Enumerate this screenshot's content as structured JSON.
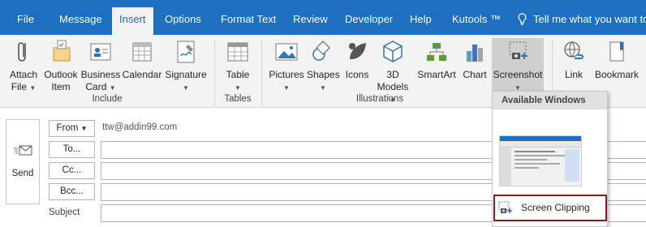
{
  "tabs": [
    {
      "label": "File",
      "active": false
    },
    {
      "label": "Message",
      "active": false
    },
    {
      "label": "Insert",
      "active": true
    },
    {
      "label": "Options",
      "active": false
    },
    {
      "label": "Format Text",
      "active": false
    },
    {
      "label": "Review",
      "active": false
    },
    {
      "label": "Developer",
      "active": false
    },
    {
      "label": "Help",
      "active": false
    },
    {
      "label": "Kutools ™",
      "active": false
    }
  ],
  "tell_me": "Tell me what you want to",
  "ribbon": {
    "buttons": {
      "attach": {
        "line1": "Attach",
        "line2": "File"
      },
      "outlook_item": {
        "line1": "Outlook",
        "line2": "Item"
      },
      "business_card": {
        "line1": "Business",
        "line2": "Card"
      },
      "calendar": {
        "line1": "Calendar"
      },
      "signature": {
        "line1": "Signature"
      },
      "table": {
        "line1": "Table"
      },
      "pictures": {
        "line1": "Pictures"
      },
      "shapes": {
        "line1": "Shapes"
      },
      "icons": {
        "line1": "Icons"
      },
      "models_3d": {
        "line1": "3D",
        "line2": "Models"
      },
      "smartart": {
        "line1": "SmartArt"
      },
      "chart": {
        "line1": "Chart"
      },
      "screenshot": {
        "line1": "Screenshot"
      },
      "link": {
        "line1": "Link"
      },
      "bookmark": {
        "line1": "Bookmark"
      }
    },
    "groups": {
      "include": "Include",
      "tables": "Tables",
      "illustrations": "Illustrations"
    }
  },
  "compose": {
    "send": "Send",
    "from_button": "From",
    "from_address": "ttw@addin99.com",
    "to_button": "To...",
    "cc_button": "Cc...",
    "bcc_button": "Bcc...",
    "subject_label": "Subject"
  },
  "screenshot_menu": {
    "header": "Available Windows",
    "screen_clipping": "Screen Clipping"
  },
  "colors": {
    "tabbar": "#1f6fc0",
    "ribbon": "#f3f3f3",
    "clip_border": "#8b1a1a"
  }
}
